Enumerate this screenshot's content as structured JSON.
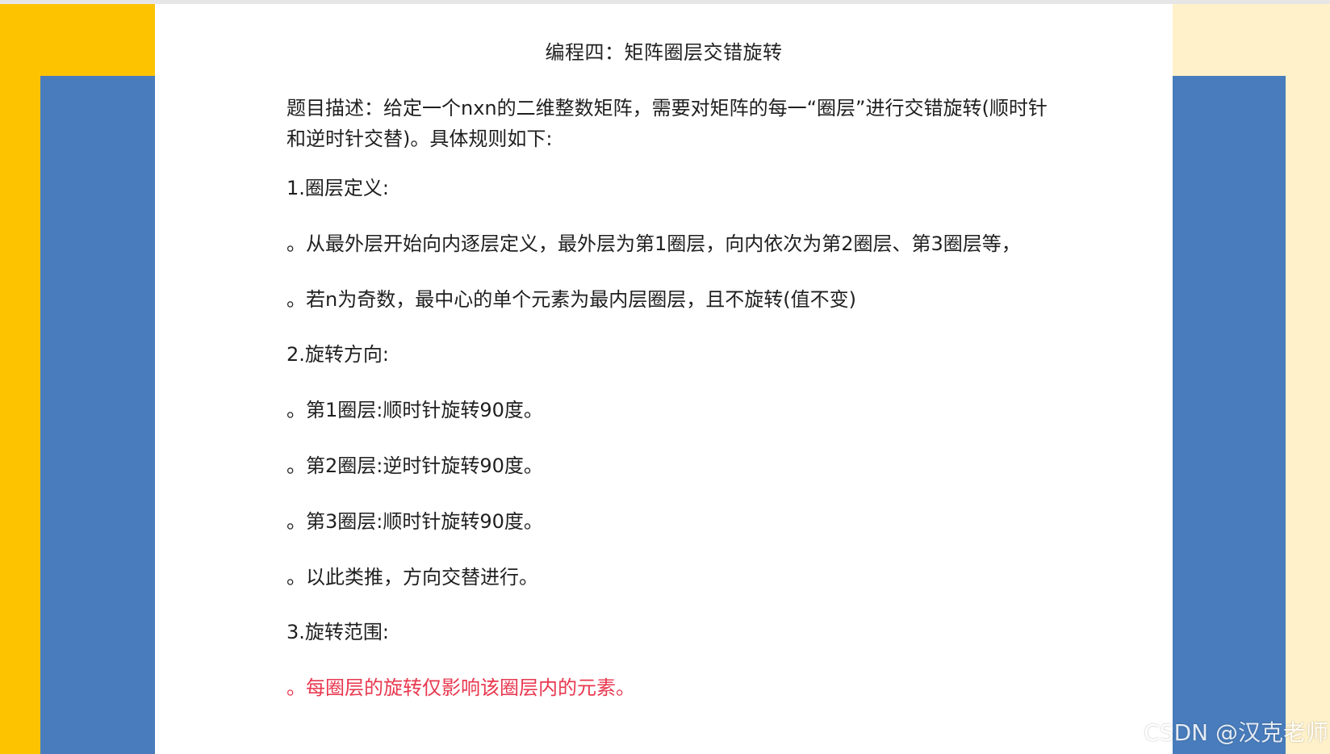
{
  "document": {
    "title": "编程四：矩阵圈层交错旋转",
    "description": "题目描述：给定一个nxn的二维整数矩阵，需要对矩阵的每一“圈层”进行交错旋转(顺时针和逆时针交替)。具体规则如下:",
    "section1_heading": "1.圈层定义:",
    "section1_item1": "。从最外层开始向内逐层定义，最外层为第1圈层，向内依次为第2圈层、第3圈层等，",
    "section1_item2": "。若n为奇数，最中心的单个元素为最内层圈层，且不旋转(值不变)",
    "section2_heading": "2.旋转方向:",
    "section2_item1": "。第1圈层:顺时针旋转90度。",
    "section2_item2": "。第2圈层:逆时针旋转90度。",
    "section2_item3": "。第3圈层:顺时针旋转90度。",
    "section2_item4": "。以此类推，方向交替进行。",
    "section3_heading": "3.旋转范围:",
    "section3_item1": "。每圈层的旋转仅影响该圈层内的元素。"
  },
  "watermark": "CSDN @汉克老师",
  "colors": {
    "yellow": "#fdc300",
    "blue": "#487cbc",
    "cream": "#fff1c9",
    "highlight_red": "#e8384f"
  }
}
